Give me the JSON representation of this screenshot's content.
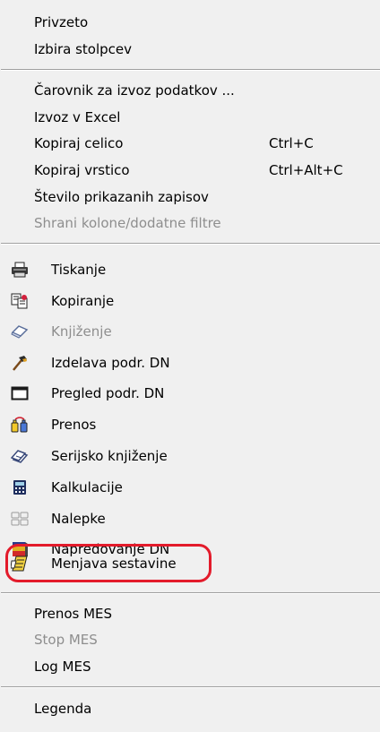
{
  "menu": {
    "group1": [
      {
        "label": "Privzeto",
        "enabled": true
      },
      {
        "label": "Izbira stolpcev",
        "enabled": true
      }
    ],
    "group2": [
      {
        "label": "Čarovnik za izvoz podatkov ...",
        "enabled": true,
        "shortcut": ""
      },
      {
        "label": "Izvoz v Excel",
        "enabled": true,
        "shortcut": ""
      },
      {
        "label": "Kopiraj celico",
        "enabled": true,
        "shortcut": "Ctrl+C"
      },
      {
        "label": "Kopiraj vrstico",
        "enabled": true,
        "shortcut": "Ctrl+Alt+C"
      },
      {
        "label": "Število prikazanih zapisov",
        "enabled": true,
        "shortcut": ""
      },
      {
        "label": "Shrani kolone/dodatne filtre",
        "enabled": false,
        "shortcut": ""
      }
    ],
    "group3": [
      {
        "label": "Tiskanje",
        "enabled": true,
        "icon": "printer-icon"
      },
      {
        "label": "Kopiranje",
        "enabled": true,
        "icon": "copy-document-icon"
      },
      {
        "label": "Knjiženje",
        "enabled": false,
        "icon": "eraser-icon"
      },
      {
        "label": "Izdelava podr. DN",
        "enabled": true,
        "icon": "hammer-icon"
      },
      {
        "label": "Pregled podr. DN",
        "enabled": true,
        "icon": "window-icon"
      },
      {
        "label": "Prenos",
        "enabled": true,
        "icon": "transfer-bottles-icon"
      },
      {
        "label": "Serijsko knjiženje",
        "enabled": true,
        "icon": "serial-posting-icon"
      },
      {
        "label": "Kalkulacije",
        "enabled": true,
        "icon": "calculator-icon"
      },
      {
        "label": "Nalepke",
        "enabled": true,
        "icon": "labels-icon"
      },
      {
        "label": "Napredovanje DN",
        "enabled": true,
        "icon": "progress-stack-icon"
      },
      {
        "label": "Menjava sestavine",
        "enabled": true,
        "icon": "swap-components-icon",
        "highlighted": true
      }
    ],
    "group4": [
      {
        "label": "Prenos MES",
        "enabled": true
      },
      {
        "label": "Stop MES",
        "enabled": false
      },
      {
        "label": "Log MES",
        "enabled": true
      }
    ],
    "group5": [
      {
        "label": "Legenda",
        "enabled": true
      }
    ]
  },
  "colors": {
    "menu_background": "#f0f0f0",
    "disabled_text": "#8e8e8e",
    "highlight_ring": "#e31b2b"
  }
}
